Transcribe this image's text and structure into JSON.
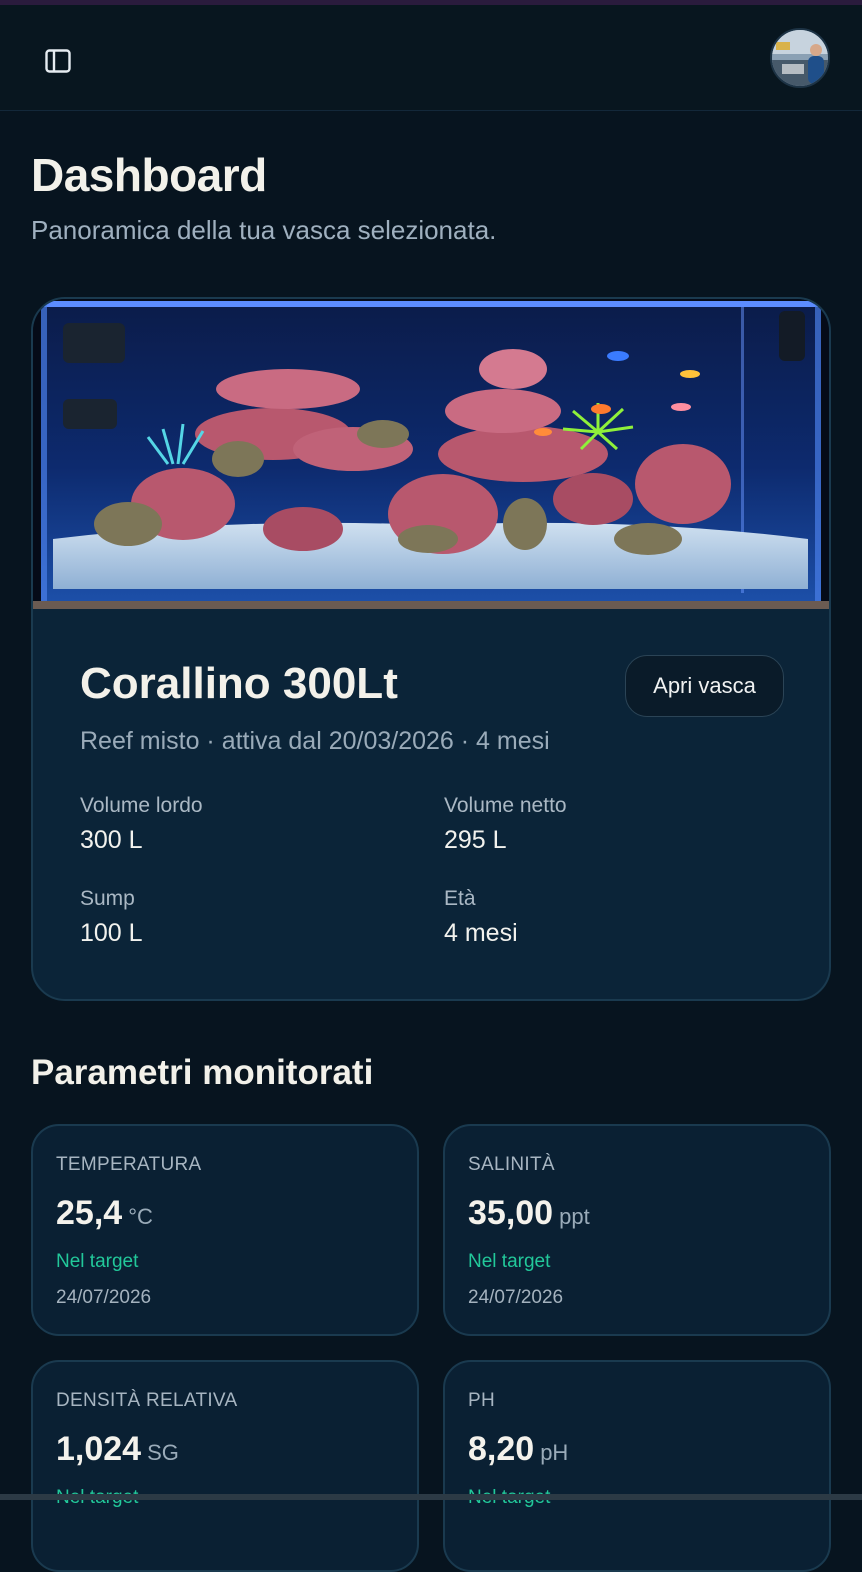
{
  "page": {
    "title": "Dashboard",
    "subtitle": "Panoramica della tua vasca selezionata."
  },
  "header": {
    "sidebar_toggle_icon": "sidebar-toggle-icon",
    "avatar_icon": "user-avatar"
  },
  "tank": {
    "name": "Corallino 300Lt",
    "open_label": "Apri vasca",
    "meta": "Reef misto · attiva dal 20/03/2026 · 4 mesi",
    "stats": [
      {
        "label": "Volume lordo",
        "value": "300 L"
      },
      {
        "label": "Volume netto",
        "value": "295 L"
      },
      {
        "label": "Sump",
        "value": "100 L"
      },
      {
        "label": "Età",
        "value": "4 mesi"
      }
    ]
  },
  "parameters": {
    "title": "Parametri monitorati",
    "items": [
      {
        "label": "TEMPERATURA",
        "value": "25,4",
        "unit": "°C",
        "status": "Nel target",
        "date": "24/07/2026"
      },
      {
        "label": "SALINITÀ",
        "value": "35,00",
        "unit": "ppt",
        "status": "Nel target",
        "date": "24/07/2026"
      },
      {
        "label": "DENSITÀ RELATIVA",
        "value": "1,024",
        "unit": "SG",
        "status": "Nel target",
        "date": ""
      },
      {
        "label": "PH",
        "value": "8,20",
        "unit": "pH",
        "status": "Nel target",
        "date": ""
      }
    ]
  },
  "colors": {
    "background": "#07141f",
    "card": "#0b2438",
    "accent_ok": "#22c89a",
    "border": "#1a3a4f"
  }
}
